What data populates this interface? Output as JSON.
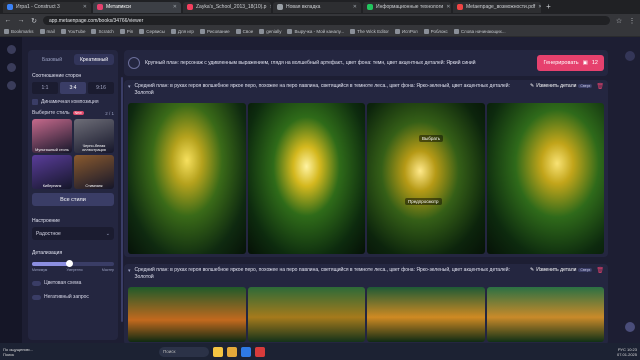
{
  "browser": {
    "tabs": [
      {
        "label": "Игра1 - Construct 3",
        "color": "#3b82f6"
      },
      {
        "label": "Метапикси",
        "color": "#e6416e",
        "active": true
      },
      {
        "label": "Zayka's_School_2013_18(10).p",
        "color": "#f43f5e"
      },
      {
        "label": "Новая вкладка",
        "color": "#9aa0a6"
      },
      {
        "label": "Информационные технологи",
        "color": "#22c55e"
      },
      {
        "label": "Metaenpage_возможности.pdf",
        "color": "#ef4444"
      }
    ],
    "url": "app.metaenpage.com/books/34766/viewer",
    "bookmarks": [
      "Bookmarks",
      "mail",
      "YouTube",
      "Scratch",
      "Pin",
      "Сервисы",
      "Для игр",
      "Рисование",
      "Свое",
      "genially",
      "Выручка - Мой каналу...",
      "The Wick Editor",
      "ИспРол",
      "Роблокс",
      "Слова начинающих..."
    ]
  },
  "panel": {
    "modes": [
      "Базовый",
      "Креативный"
    ],
    "ratio_label": "Соотношение сторон",
    "ratios": [
      "1:1",
      "3:4",
      "9:16"
    ],
    "dynamic": "Динамичная композиция",
    "style_label": "Выберите стиль",
    "style_badge": "New",
    "pager": "2 / 1",
    "styles": [
      {
        "name": "Мультяшный стиль",
        "color": "#c66a8c"
      },
      {
        "name": "Черно-белая иллюстрация",
        "color": "#6e6e78"
      },
      {
        "name": "Киберпанк",
        "color": "#5a3d9a"
      },
      {
        "name": "Стимпанк",
        "color": "#8a5a2e"
      }
    ],
    "all_styles": "Все стили",
    "mood_label": "Настроение",
    "mood_value": "Радостное",
    "detail_label": "Детализация",
    "detail_ticks": [
      "Минимум",
      "Умеренно",
      "Мастер"
    ],
    "detail_level": 0.45,
    "color_scheme": "Цветовая схема",
    "negative": "Негативный запрос"
  },
  "prompt": {
    "text": "Крупный план: персонаж с удивленным выражением, глядя на волшебный артефакт., цвет фона: темн, цвет акцентных деталей: Яркий синий",
    "generate": "Генерировать",
    "credits": "12"
  },
  "generations": [
    {
      "text": "Средний план: в руках героя волшебное яркое перо, похожее на перо павлина, светящийся в темноте леса., цвет фона: Ярко-зеленый, цвет акцентных деталей: Золотой",
      "edit": "Изменить детали",
      "tag": "Сверх",
      "tooltips": [
        "Выбрать",
        "Предпросмотр"
      ]
    },
    {
      "text": "Средний план: в руках героя волшебное яркое перо, похожее на перо павлина, светящийся в темноте леса., цвет фона: Ярко-зеленый, цвет акцентных деталей: Золотой",
      "edit": "Изменить детали",
      "tag": "Сверх"
    }
  ],
  "taskbar": {
    "weather": "По ощущению... Поиск",
    "search": "Поиск",
    "time": "10:23",
    "date": "07.01.2025",
    "lang": "РУС"
  }
}
